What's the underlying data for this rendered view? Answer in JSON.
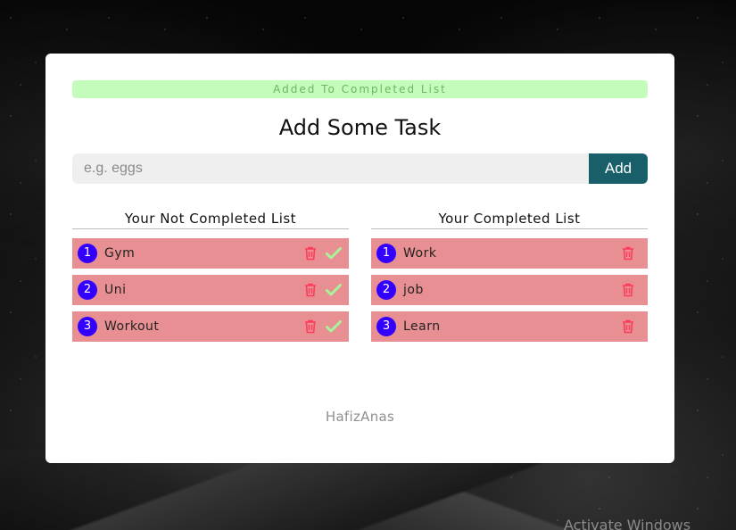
{
  "alert": {
    "text": "Added To Completed List"
  },
  "heading": "Add Some Task",
  "input": {
    "placeholder": "e.g. eggs",
    "value": ""
  },
  "add_button": "Add",
  "not_completed": {
    "title": "Your Not Completed List",
    "items": [
      {
        "num": "1",
        "label": "Gym"
      },
      {
        "num": "2",
        "label": "Uni"
      },
      {
        "num": "3",
        "label": "Workout"
      }
    ]
  },
  "completed": {
    "title": "Your Completed List",
    "items": [
      {
        "num": "1",
        "label": "Work"
      },
      {
        "num": "2",
        "label": "job"
      },
      {
        "num": "3",
        "label": "Learn"
      }
    ]
  },
  "footer": "HafizAnas",
  "watermark": "Activate Windows",
  "colors": {
    "alert_bg": "#c4fcbb",
    "alert_text": "#6fb563",
    "add_button": "#185f69",
    "item_bg": "#e88f93",
    "num_badge": "#3300ff",
    "trash_icon": "#ff3b5c",
    "check_icon": "#a6f59a"
  },
  "icons": {
    "delete": "trash-icon",
    "complete": "check-icon"
  }
}
